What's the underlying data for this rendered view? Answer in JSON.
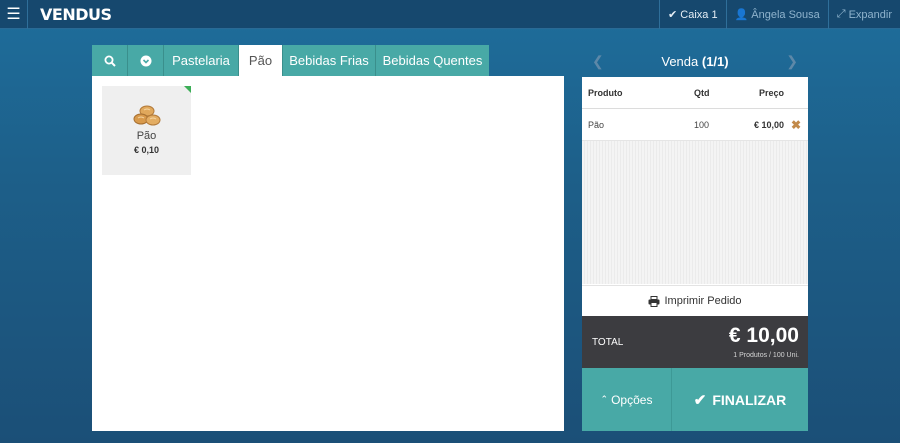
{
  "app": {
    "logo": "VENDUS"
  },
  "topbar": {
    "menu_icon": "hamburger-icon",
    "caixa": "Caixa 1",
    "user": "Ângela Sousa",
    "expand": "Expandir"
  },
  "categories": {
    "tabs": [
      {
        "label": "Pastelaria",
        "active": false
      },
      {
        "label": "Pão",
        "active": true
      },
      {
        "label": "Bebidas Frias",
        "active": false
      },
      {
        "label": "Bebidas Quentes",
        "active": false
      }
    ]
  },
  "products": [
    {
      "name": "Pão",
      "price": "€ 0,10",
      "icon": "bread-icon"
    }
  ],
  "sale": {
    "title_prefix": "Venda",
    "title_count": "(1/1)",
    "columns": {
      "product": "Produto",
      "qty": "Qtd",
      "price": "Preço"
    },
    "rows": [
      {
        "product": "Pão",
        "qty": "100",
        "price": "€ 10,00"
      }
    ],
    "print_label": "Imprimir Pedido",
    "total_label": "TOTAL",
    "total_value": "€ 10,00",
    "total_sub": "1 Produtos / 100 Uni.",
    "options_label": "Opções",
    "finalize_label": "FINALIZAR"
  },
  "colors": {
    "accent": "#48a9a6",
    "topbar": "#16486e",
    "total_bg": "#3c3c40"
  }
}
